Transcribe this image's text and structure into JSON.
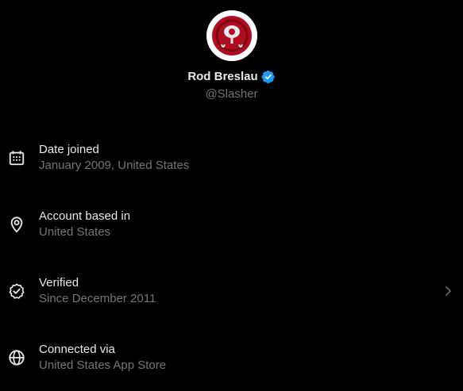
{
  "profile": {
    "name": "Rod Breslau",
    "handle": "@Slasher",
    "verified": true,
    "badge_color": "#1d9bf0"
  },
  "rows": [
    {
      "icon": "calendar-icon",
      "title": "Date joined",
      "subtitle": "January 2009, United States"
    },
    {
      "icon": "location-pin-icon",
      "title": "Account based in",
      "subtitle": "United States"
    },
    {
      "icon": "verified-badge-icon",
      "title": "Verified",
      "subtitle": "Since December 2011"
    },
    {
      "icon": "globe-icon",
      "title": "Connected via",
      "subtitle": "United States App Store"
    }
  ],
  "colors": {
    "background": "#000000",
    "primary_text": "#e7e9ea",
    "secondary_text": "#71767b",
    "avatar_red": "#c8102e"
  }
}
